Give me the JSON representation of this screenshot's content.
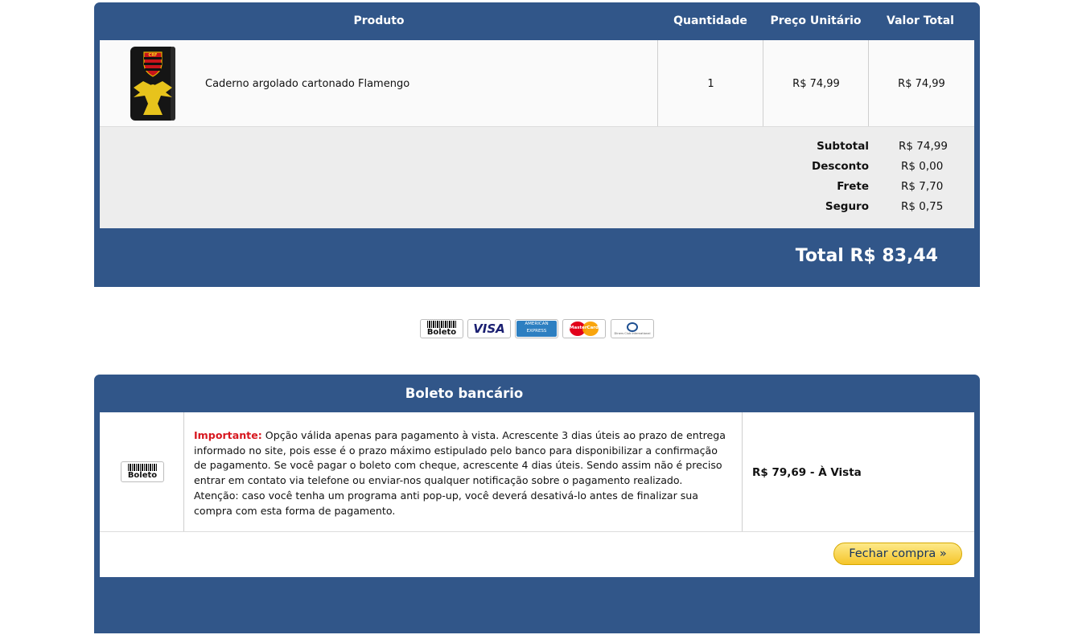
{
  "cart": {
    "headers": {
      "product": "Produto",
      "quantity": "Quantidade",
      "unit_price": "Preço Unitário",
      "total_value": "Valor Total"
    },
    "item": {
      "name": "Caderno argolado cartonado Flamengo",
      "quantity": "1",
      "unit_price": "R$ 74,99",
      "total_value": "R$ 74,99"
    },
    "summary": [
      {
        "label": "Subtotal",
        "value": "R$ 74,99"
      },
      {
        "label": "Desconto",
        "value": "R$ 0,00"
      },
      {
        "label": "Frete",
        "value": "R$ 7,70"
      },
      {
        "label": "Seguro",
        "value": "R$ 0,75"
      }
    ],
    "grand_total": "Total R$ 83,44"
  },
  "payment_methods": [
    {
      "label": "Boleto",
      "icon": "boleto-icon"
    },
    {
      "label": "VISA",
      "icon": "visa-icon"
    },
    {
      "label": "AMERICAN EXPRESS",
      "icon": "amex-icon"
    },
    {
      "label": "MasterCard",
      "icon": "mastercard-icon"
    },
    {
      "label": "Diners Club International",
      "icon": "diners-icon"
    }
  ],
  "boleto": {
    "title": "Boleto bancário",
    "icon_label": "Boleto",
    "important_label": "Importante:",
    "description": " Opção válida apenas para pagamento à vista. Acrescente 3 dias úteis ao prazo de entrega informado no site, pois esse é o prazo máximo estipulado pelo banco para disponibilizar a confirmação de pagamento. Se você pagar o boleto com cheque, acrescente 4 dias úteis. Sendo assim não é preciso entrar em contato via telefone ou enviar-nos qualquer notificação sobre o pagamento realizado. Atenção: caso você tenha um programa anti pop-up, você deverá desativá-lo antes de finalizar sua compra com esta forma de pagamento.",
    "price": "R$ 79,69 - À Vista",
    "button_label": "Fechar compra »"
  },
  "colors": {
    "panel": "#315689",
    "important": "#d7171f",
    "button": "#f5c52a"
  }
}
